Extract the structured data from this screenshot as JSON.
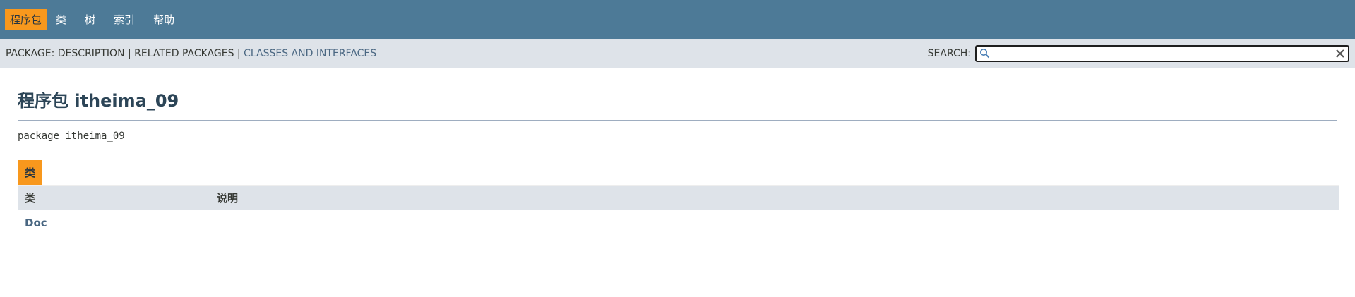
{
  "top_nav": {
    "items": [
      {
        "label": "程序包",
        "active": true
      },
      {
        "label": "类",
        "active": false
      },
      {
        "label": "树",
        "active": false
      },
      {
        "label": "索引",
        "active": false
      },
      {
        "label": "帮助",
        "active": false
      }
    ]
  },
  "sub_nav": {
    "package_prefix": "PACKAGE: ",
    "description": "DESCRIPTION",
    "sep1": " | ",
    "related": "RELATED PACKAGES",
    "sep2": " | ",
    "classes_link": "CLASSES AND INTERFACES"
  },
  "search": {
    "label": "SEARCH:",
    "value": "",
    "placeholder": ""
  },
  "page": {
    "title": "程序包 itheima_09",
    "signature": "package itheima_09"
  },
  "classes_table": {
    "caption": "类",
    "headers": {
      "col1": "类",
      "col2": "说明"
    },
    "rows": [
      {
        "name": "Doc",
        "description": ""
      }
    ]
  },
  "colors": {
    "nav_bg": "#4d7a97",
    "accent": "#f8981d",
    "subnav_bg": "#dee3e9",
    "link": "#4a6782"
  },
  "icons": [
    "search-icon",
    "clear-icon"
  ]
}
